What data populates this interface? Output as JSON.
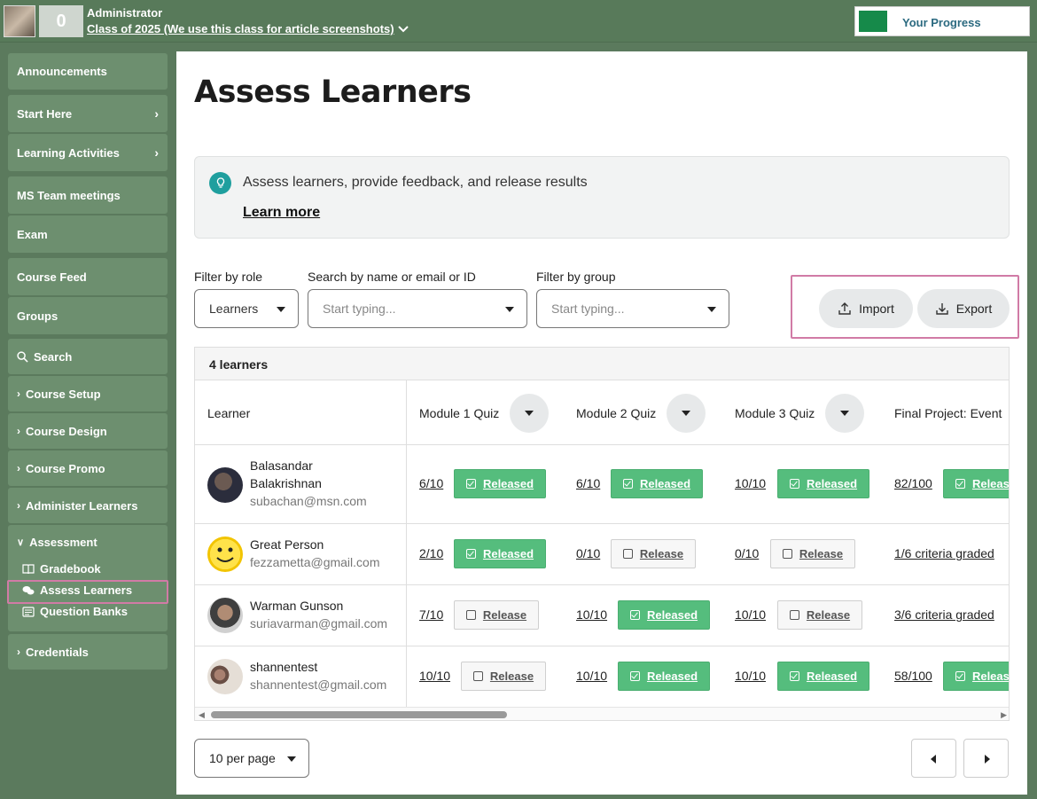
{
  "topbar": {
    "points": "0",
    "role": "Administrator",
    "class_name": "Class of 2025 (We use this class for article screenshots)",
    "progress_label": "Your Progress"
  },
  "sidebar": {
    "announcements": "Announcements",
    "start_here": "Start Here",
    "learning_activities": "Learning Activities",
    "ms_team": "MS Team meetings",
    "exam": "Exam",
    "course_feed": "Course Feed",
    "groups": "Groups",
    "search": "Search",
    "course_setup": "Course Setup",
    "course_design": "Course Design",
    "course_promo": "Course Promo",
    "administer_learners": "Administer Learners",
    "assessment": "Assessment",
    "gradebook": "Gradebook",
    "assess_learners": "Assess Learners",
    "question_banks": "Question Banks",
    "credentials": "Credentials"
  },
  "main": {
    "title": "Assess Learners",
    "info_text": "Assess learners, provide feedback, and release results",
    "info_link": "Learn more",
    "filter_role_label": "Filter by role",
    "filter_role_value": "Learners",
    "search_label": "Search by name or email or ID",
    "search_placeholder": "Start typing...",
    "group_label": "Filter by group",
    "group_placeholder": "Start typing...",
    "import_label": "Import",
    "export_label": "Export"
  },
  "table": {
    "count": "4 learners",
    "headers": {
      "learner": "Learner",
      "m1": "Module 1 Quiz",
      "m2": "Module 2 Quiz",
      "m3": "Module 3 Quiz",
      "fp": "Final Project: Event"
    },
    "rows": [
      {
        "name": "Balasandar Balakrishnan",
        "email": "subachan@msn.com",
        "m1": "6/10",
        "m1_btn": "Released",
        "m2": "6/10",
        "m2_btn": "Released",
        "m3": "10/10",
        "m3_btn": "Released",
        "fp": "82/100",
        "fp_btn": "Released"
      },
      {
        "name": "Great Person",
        "email": "fezzametta@gmail.com",
        "m1": "2/10",
        "m1_btn": "Released",
        "m2": "0/10",
        "m2_btn": "Release",
        "m3": "0/10",
        "m3_btn": "Release",
        "fp": "1/6 criteria graded"
      },
      {
        "name": "Warman Gunson",
        "email": "suriavarman@gmail.com",
        "m1": "7/10",
        "m1_btn": "Release",
        "m2": "10/10",
        "m2_btn": "Released",
        "m3": "10/10",
        "m3_btn": "Release",
        "fp": "3/6 criteria graded"
      },
      {
        "name": "shannentest",
        "email": "shannentest@gmail.com",
        "m1": "10/10",
        "m1_btn": "Release",
        "m2": "10/10",
        "m2_btn": "Released",
        "m3": "10/10",
        "m3_btn": "Released",
        "fp": "58/100",
        "fp_btn": "Released"
      }
    ]
  },
  "footer": {
    "per_page": "10 per page"
  },
  "colors": {
    "background": "#5b7a5d",
    "nav_item": "#6d8f6f",
    "released": "#55bd7d",
    "highlight": "#d17ba6",
    "info_icon": "#1f9f9e"
  }
}
